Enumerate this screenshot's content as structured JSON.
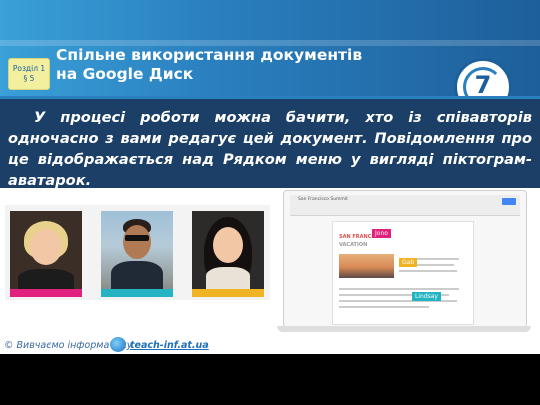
{
  "header": {
    "section_line1": "Розділ 1",
    "section_line2": "§ 5",
    "title_line1": "Спільне використання документів",
    "title_line2": "на Google Диск",
    "grade": "7"
  },
  "body_text": "У процесі роботи можна бачити, хто із співавторів одночасно з вами редагує цей документ. Повідомлення про це відображається над Рядком меню у вигляді піктограм-аватарок.",
  "collaborators": [
    {
      "tag": "Jono",
      "color": "#e0227e"
    },
    {
      "tag": "Gab",
      "color": "#f0b323"
    },
    {
      "tag": "Lindsay",
      "color": "#23b3c3"
    }
  ],
  "doc": {
    "window_title": "San Francisco Summit",
    "heading1": "SAN FRANCISCO",
    "heading2": "VACATION"
  },
  "footer": {
    "copyright": "© Вивчаємо інформатику",
    "site": "teach-inf.at.ua"
  }
}
